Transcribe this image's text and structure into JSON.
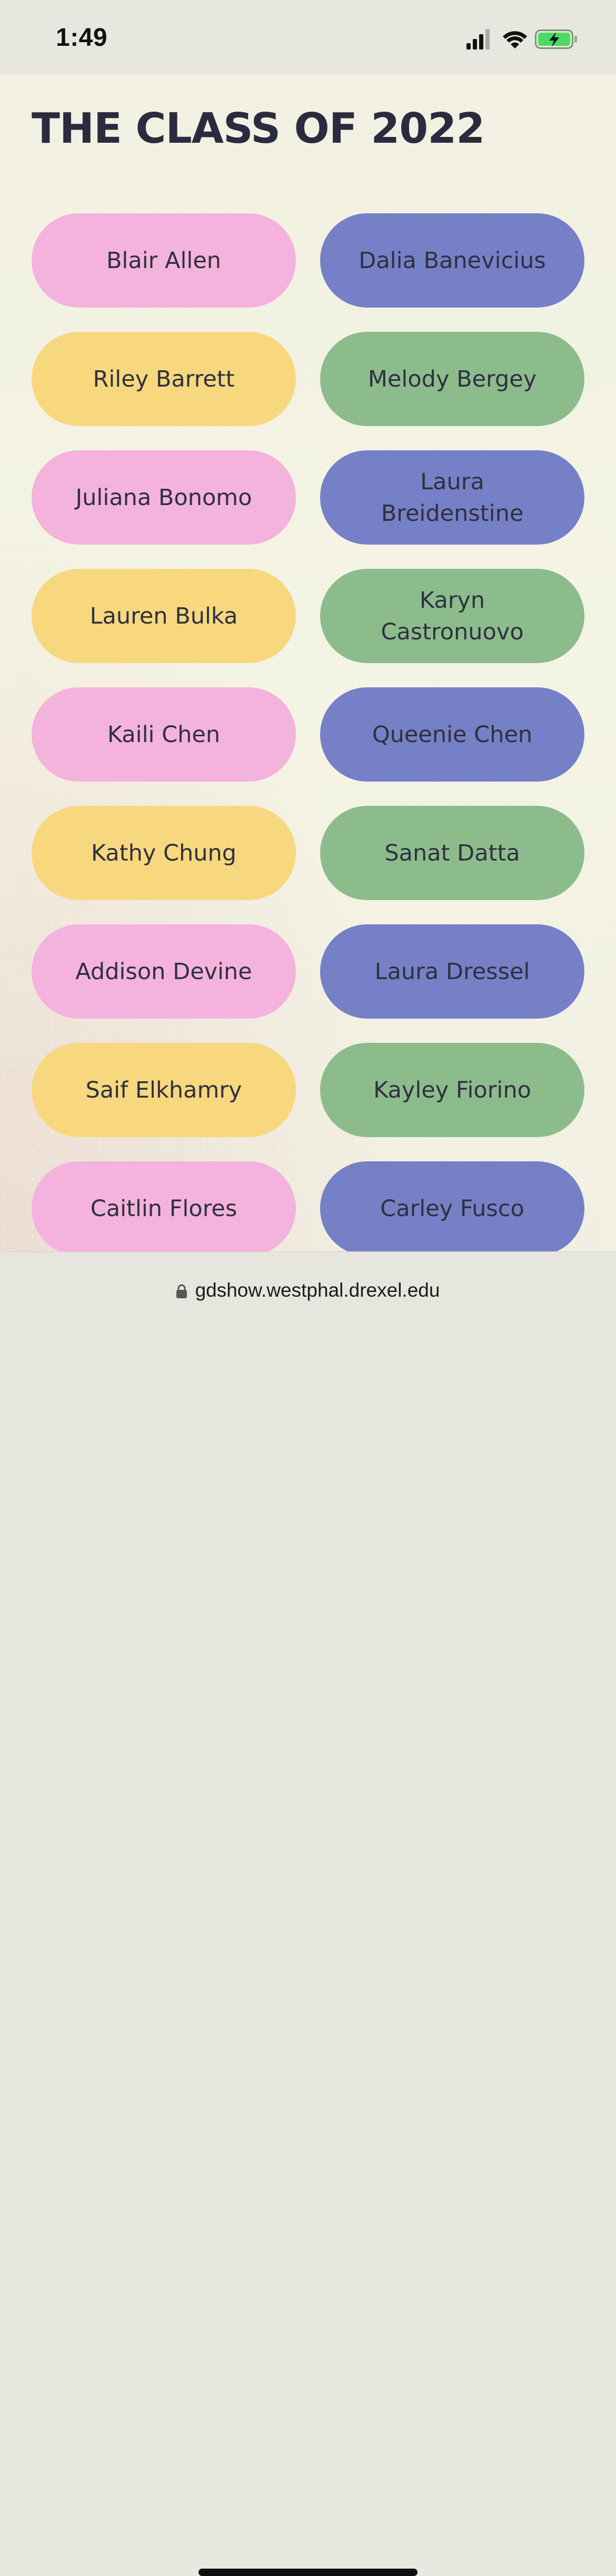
{
  "status_bar": {
    "time": "1:49"
  },
  "page": {
    "title": "THE CLASS OF 2022"
  },
  "colors": {
    "pink": "#f4b3dc",
    "purple": "#7680c6",
    "yellow": "#f7d87e",
    "green": "#8dbc8c",
    "title_text": "#2b2b3f"
  },
  "students": [
    {
      "name": "Blair Allen",
      "color": "pink"
    },
    {
      "name": "Dalia Banevicius",
      "color": "purple"
    },
    {
      "name": "Riley Barrett",
      "color": "yellow"
    },
    {
      "name": "Melody Bergey",
      "color": "green"
    },
    {
      "name": "Juliana Bonomo",
      "color": "pink"
    },
    {
      "name": "Laura Breidenstine",
      "color": "purple"
    },
    {
      "name": "Lauren Bulka",
      "color": "yellow"
    },
    {
      "name": "Karyn Castronuovo",
      "color": "green"
    },
    {
      "name": "Kaili Chen",
      "color": "pink"
    },
    {
      "name": "Queenie Chen",
      "color": "purple"
    },
    {
      "name": "Kathy Chung",
      "color": "yellow"
    },
    {
      "name": "Sanat Datta",
      "color": "green"
    },
    {
      "name": "Addison Devine",
      "color": "pink"
    },
    {
      "name": "Laura Dressel",
      "color": "purple"
    },
    {
      "name": "Saif Elkhamry",
      "color": "yellow"
    },
    {
      "name": "Kayley Fiorino",
      "color": "green"
    },
    {
      "name": "Caitlin Flores",
      "color": "pink"
    },
    {
      "name": "Carley Fusco",
      "color": "purple"
    }
  ],
  "browser": {
    "url": "gdshow.westphal.drexel.edu"
  }
}
